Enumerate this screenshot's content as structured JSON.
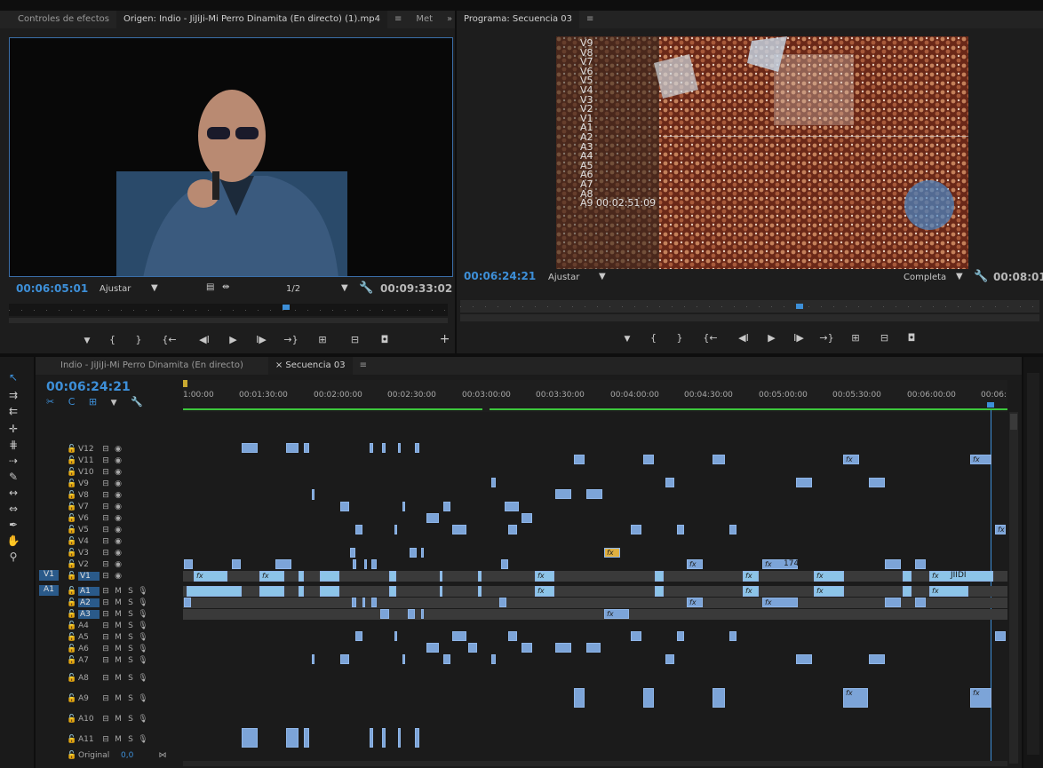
{
  "source_monitor": {
    "tabs": [
      "Controles de efectos",
      "Origen: Indio - JiJiJi-Mi Perro Dinamita (En directo) (1).mp4",
      "≡",
      "Met",
      "»"
    ],
    "timecode": "00:06:05:01",
    "fit": "Ajustar",
    "resolution": "1/2",
    "duration": "00:09:33:02"
  },
  "program_monitor": {
    "title": "Programa: Secuencia 03",
    "menu": "≡",
    "timecode": "00:06:24:21",
    "fit": "Ajustar",
    "quality": "Completa",
    "duration": "00:08:01",
    "overlay_labels": [
      "V9",
      "V8",
      "V7",
      "V6",
      "V5",
      "V4",
      "V3",
      "V2",
      "V1",
      "A1",
      "A2",
      "A3",
      "A4",
      "A5",
      "A6",
      "A7",
      "A8",
      "A9  00:02:51:09"
    ]
  },
  "transport": {
    "marker": "▼",
    "in": "{",
    "out": "}",
    "go_in": "{←",
    "step_back": "◀I",
    "play": "▶",
    "step_fwd": "I▶",
    "go_out": "→}",
    "insert": "⊞",
    "overwrite": "⊟",
    "export_frame": "◘",
    "add": "+"
  },
  "timeline": {
    "tabs": [
      "Indio - JiJiJi-Mi Perro Dinamita (En directo)",
      "× Secuencia 03",
      "≡"
    ],
    "timecode": "00:06:24:21",
    "ruler_labels": [
      "1:00:00",
      "00:01:30:00",
      "00:02:00:00",
      "00:02:30:00",
      "00:03:00:00",
      "00:03:30:00",
      "00:04:00:00",
      "00:04:30:00",
      "00:05:00:00",
      "00:05:30:00",
      "00:06:00:00",
      "00:06:"
    ],
    "video_tracks": [
      "V12",
      "V11",
      "V10",
      "V9",
      "V8",
      "V7",
      "V6",
      "V5",
      "V4",
      "V3",
      "V2",
      "V1"
    ],
    "audio_tracks": [
      "A1",
      "A2",
      "A3",
      "A4",
      "A5",
      "A6",
      "A7",
      "A8",
      "A9",
      "A10",
      "A11"
    ],
    "source_patch_v": "V1",
    "source_patch_a": "A1",
    "master": "Original",
    "master_value": "0,0",
    "clip_labels": [
      "174",
      "JIIDI"
    ]
  },
  "colors": {
    "accent": "#3d8fd8",
    "video_clip": "#7ca4d8",
    "audio_clip": "#8cc4e8",
    "work_area": "#3cc83c"
  }
}
